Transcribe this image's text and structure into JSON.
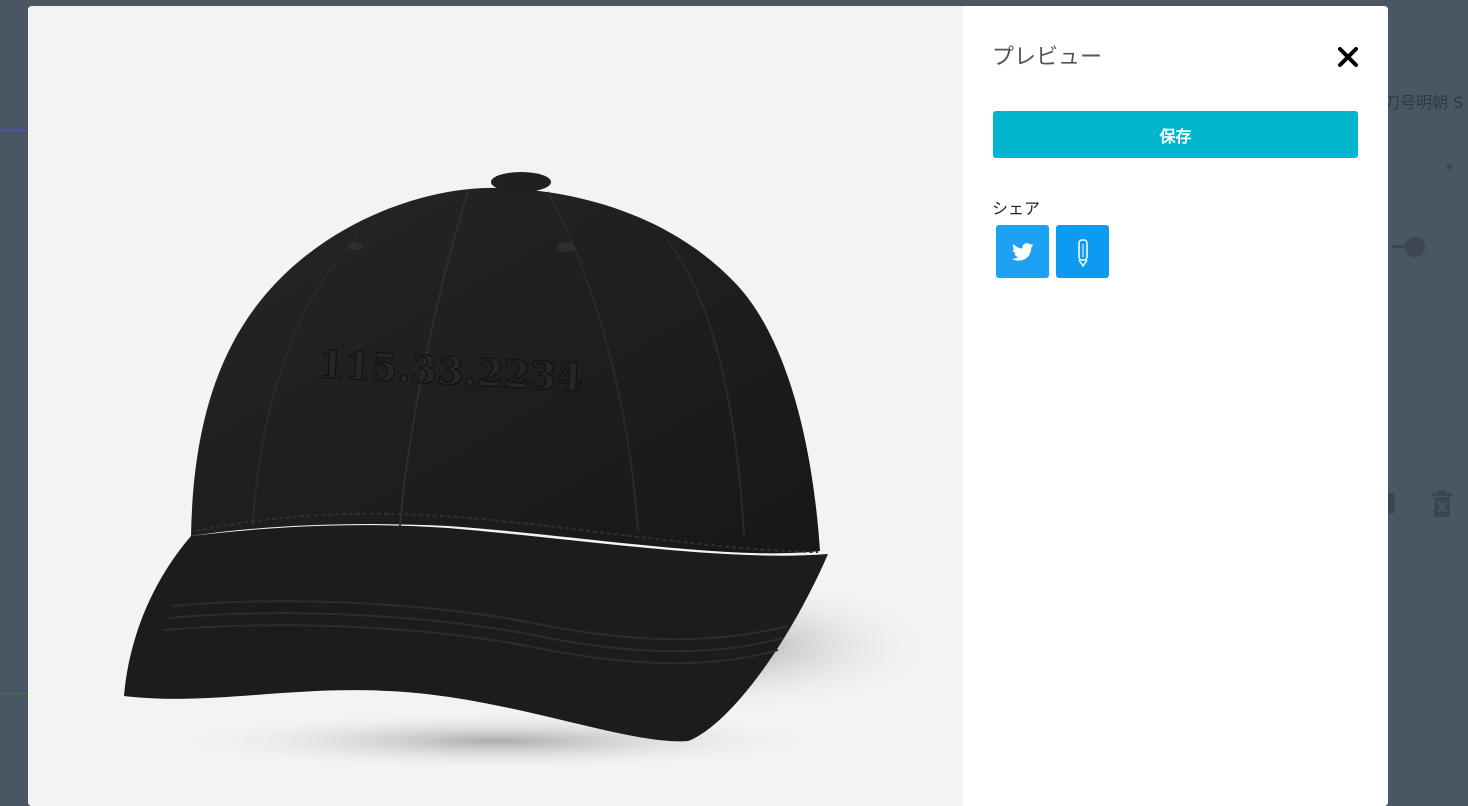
{
  "modal": {
    "title": "プレビュー",
    "save_label": "保存",
    "share_label": "シェア",
    "share_buttons": [
      {
        "name": "twitter",
        "icon": "twitter-icon",
        "color": "#1da1f2"
      },
      {
        "name": "note",
        "icon": "pencil-icon",
        "color": "#0d9bf2"
      }
    ],
    "close_icon": "close-icon"
  },
  "preview": {
    "product": "black baseball cap",
    "embroidery_text": "115.33.2234"
  },
  "background": {
    "font_label": "刀号明朝 S"
  },
  "colors": {
    "overlay": "#4a5663",
    "accent": "#00b6cf",
    "twitter": "#1da1f2",
    "cap": "#1f1f1f"
  }
}
